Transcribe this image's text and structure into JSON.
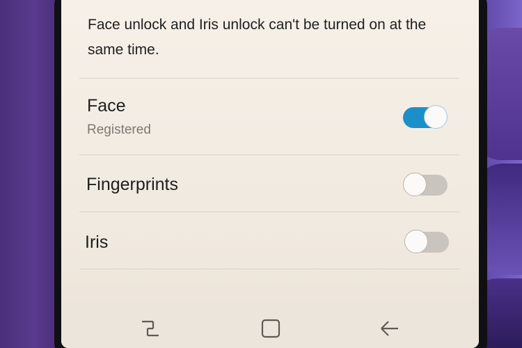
{
  "notice": "Face unlock and Iris unlock can't be turned on at the same time.",
  "options": [
    {
      "label": "Face",
      "sublabel": "Registered",
      "enabled": true
    },
    {
      "label": "Fingerprints",
      "sublabel": "",
      "enabled": false
    },
    {
      "label": "Iris",
      "sublabel": "",
      "enabled": false
    }
  ],
  "navbar": {
    "buttons": [
      "recent-apps-icon",
      "home-icon",
      "back-icon"
    ]
  },
  "colors": {
    "toggle_on": "#1b8fc9",
    "toggle_off": "#c9c4bd",
    "screen_bg": "#f4eee6"
  }
}
